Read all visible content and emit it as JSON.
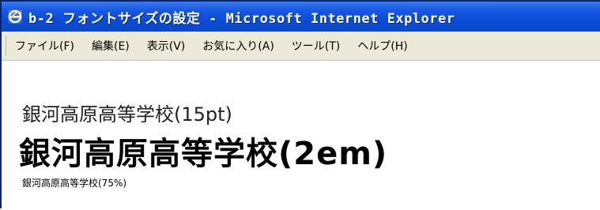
{
  "window": {
    "title": "b-2 フォントサイズの設定 - Microsoft Internet Explorer",
    "icon": "ie-icon"
  },
  "menu": {
    "items": [
      {
        "label": "ファイル(F)"
      },
      {
        "label": "編集(E)"
      },
      {
        "label": "表示(V)"
      },
      {
        "label": "お気に入り(A)"
      },
      {
        "label": "ツール(T)"
      },
      {
        "label": "ヘルプ(H)"
      }
    ]
  },
  "content": {
    "line_15pt": "銀河高原高等学校(15pt)",
    "line_2em": "銀河高原高等学校(2em)",
    "line_75pct": "銀河高原高等学校(75%)"
  },
  "colors": {
    "titlebar": "#0a4bd6",
    "menubar": "#ece9d8",
    "page_bg": "#ffffff"
  }
}
